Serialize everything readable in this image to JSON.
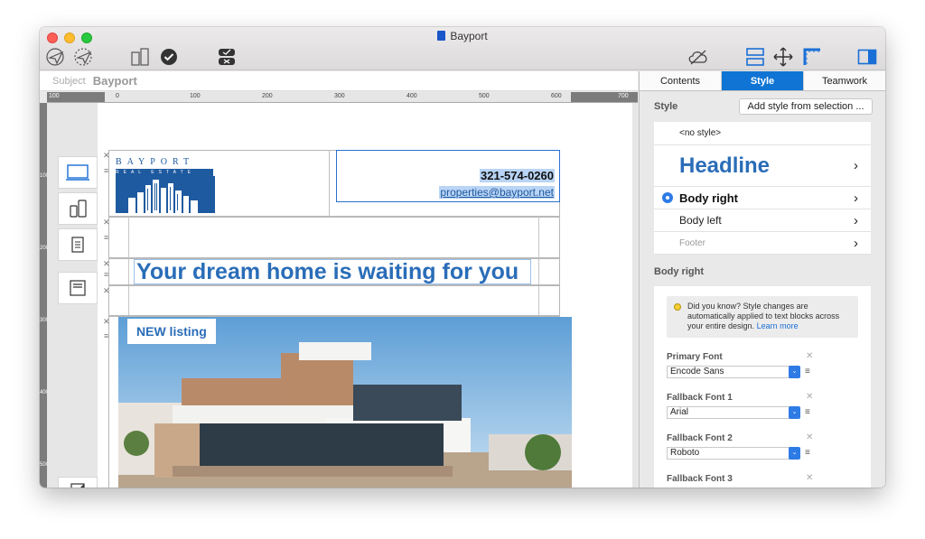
{
  "window": {
    "title": "Bayport"
  },
  "subject": {
    "label": "Subject",
    "value": "Bayport"
  },
  "ruler": {
    "h_ticks": [
      "100",
      "0",
      "100",
      "200",
      "300",
      "400",
      "500",
      "600",
      "700"
    ],
    "v_ticks": [
      "100",
      "200",
      "300",
      "400",
      "500"
    ]
  },
  "header_block": {
    "logo_name": "BAYPORT",
    "logo_sub": "REAL ESTATE",
    "phone": "321-574-0260",
    "email": "properties@bayport.net"
  },
  "headline": "Your dream home is waiting for you",
  "badge": "NEW listing",
  "colors": {
    "accent": "#0f74d3",
    "headline_blue": "#2a6db8",
    "logo_blue": "#1e5aa0"
  },
  "tabs": [
    "Contents",
    "Style",
    "Teamwork"
  ],
  "style_panel": {
    "section_label": "Style",
    "add_button": "Add style from selection ...",
    "styles": [
      {
        "label": "<no style>"
      },
      {
        "label": "Headline"
      },
      {
        "label": "Body right",
        "selected": true
      },
      {
        "label": "Body left"
      },
      {
        "label": "Footer"
      }
    ],
    "selected_title": "Body right",
    "tip": "Did you know? Style changes are automatically applied to text blocks across your entire design.",
    "tip_link": "Learn more",
    "fonts": [
      {
        "label": "Primary Font",
        "value": "Encode Sans"
      },
      {
        "label": "Fallback Font 1",
        "value": "Arial"
      },
      {
        "label": "Fallback Font 2",
        "value": "Roboto"
      },
      {
        "label": "Fallback Font 3",
        "value": ""
      }
    ]
  }
}
